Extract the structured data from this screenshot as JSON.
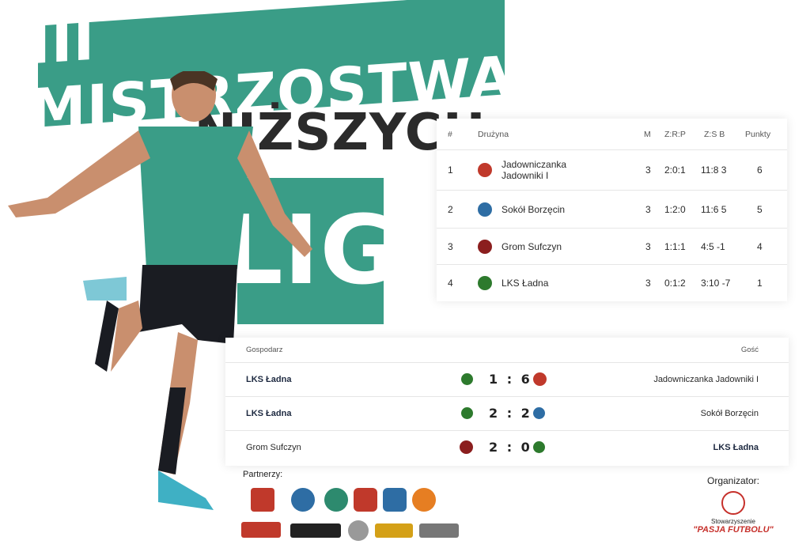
{
  "banner": {
    "line1": "III MISTRZOSTWA",
    "line2": "NIŻSZYCH",
    "line3": "LIG"
  },
  "standings": {
    "headers": [
      "#",
      "Drużyna",
      "M",
      "Z:R:P",
      "Z:S B",
      "Punkty"
    ],
    "rows": [
      {
        "pos": "1",
        "team": "Jadowniczanka Jadowniki I",
        "m": "3",
        "zrp": "2:0:1",
        "zsb": "11:8 3",
        "pts": "6",
        "crest": "#c0392b"
      },
      {
        "pos": "2",
        "team": "Sokół Borzęcin",
        "m": "3",
        "zrp": "1:2:0",
        "zsb": "11:6 5",
        "pts": "5",
        "crest": "#2e6da4"
      },
      {
        "pos": "3",
        "team": "Grom Sufczyn",
        "m": "3",
        "zrp": "1:1:1",
        "zsb": "4:5 -1",
        "pts": "4",
        "crest": "#8b1e1e"
      },
      {
        "pos": "4",
        "team": "LKS Ładna",
        "m": "3",
        "zrp": "0:1:2",
        "zsb": "3:10 -7",
        "pts": "1",
        "crest": "#2d7a2d"
      }
    ]
  },
  "results": {
    "home_label": "Gospodarz",
    "away_label": "Gość",
    "matches": [
      {
        "home": "LKS Ładna",
        "score": "1 : 6",
        "away": "Jadowniczanka Jadowniki I",
        "home_bold": true,
        "away_bold": false,
        "home_crest": "#2d7a2d",
        "away_crest": "#c0392b"
      },
      {
        "home": "LKS Ładna",
        "score": "2 : 2",
        "away": "Sokół Borzęcin",
        "home_bold": true,
        "away_bold": false,
        "home_crest": "#2d7a2d",
        "away_crest": "#2e6da4"
      },
      {
        "home": "Grom Sufczyn",
        "score": "2 : 0",
        "away": "LKS Ładna",
        "home_bold": false,
        "away_bold": true,
        "home_crest": "#8b1e1e",
        "away_crest": "#2d7a2d"
      }
    ]
  },
  "partners": {
    "label": "Partnerzy:",
    "logo_colors": [
      "#c0392b",
      "#2e6da4",
      "#2d8a6e",
      "#c0392b",
      "#2e6da4",
      "#e67e22",
      "#c0392b",
      "#222222",
      "#999999",
      "#d4a017",
      "#777777"
    ]
  },
  "organizer": {
    "label": "Organizator:",
    "sub": "Stowarzyszenie",
    "name": "\"PASJA FUTBOLU\""
  },
  "colors": {
    "accent": "#3a9d87",
    "text_dark": "#1d2940"
  }
}
